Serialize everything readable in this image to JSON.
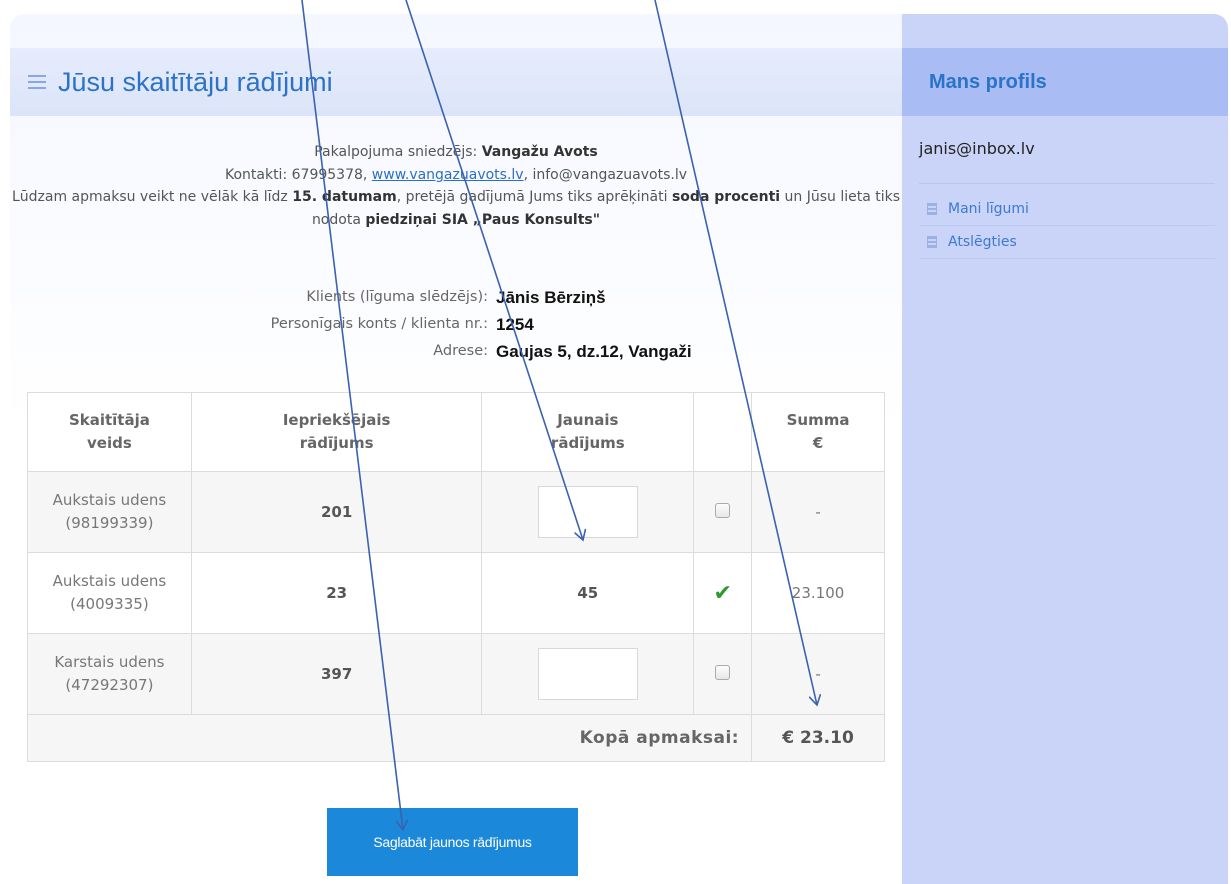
{
  "main": {
    "title": "Jūsu skaitītāju rādījumi",
    "provider": {
      "label": "Pakalpojuma sniedzējs:",
      "name": "Vangažu Avots",
      "contacts_label": "Kontakti:",
      "phone": "67995378",
      "website": "www.vangazuavots.lv",
      "email": "info@vangazuavots.lv",
      "notice_part1": "Lūdzam apmaksu veikt ne vēlāk kā līdz",
      "notice_date": "15. datumam",
      "notice_part2": ", pretējā gadījumā Jums tiks aprēķināti",
      "notice_penalty": "soda procenti",
      "notice_part3": "un Jūsu lieta tiks nodota",
      "notice_collector": "piedziņai SIA „Paus Konsults\""
    },
    "client": {
      "client_label": "Klients (līguma slēdzējs):",
      "client_name": "Jānis Bērziņš",
      "account_label": "Personīgais konts / klienta nr.:",
      "account_number": "1254",
      "address_label": "Adrese:",
      "address": "Gaujas 5, dz.12, Vangaži"
    },
    "table": {
      "headers": {
        "type_line1": "Skaitītāja",
        "type_line2": "veids",
        "prev_line1": "Iepriekšējais",
        "prev_line2": "rādījums",
        "new_line1": "Jaunais",
        "new_line2": "rādījums",
        "sum_line1": "Summa",
        "sum_line2": "€"
      },
      "rows": [
        {
          "type": "Aukstais udens",
          "id": "(98199339)",
          "previous": "201",
          "new": "",
          "sum": "-"
        },
        {
          "type": "Aukstais udens",
          "id": "(4009335)",
          "previous": "23",
          "new": "45",
          "sum": "23.100"
        },
        {
          "type": "Karstais udens",
          "id": "(47292307)",
          "previous": "397",
          "new": "",
          "sum": "-"
        }
      ],
      "total_label": "Kopā apmaksai:",
      "total_value": "€ 23.10"
    },
    "save_button": "Saglabāt jaunos rādījumus"
  },
  "sidebar": {
    "title": "Mans profils",
    "email": "janis@inbox.lv",
    "items": [
      {
        "label": "Mani līgumi",
        "icon": "document-icon"
      },
      {
        "label": "Atslēgties",
        "icon": "document-icon"
      }
    ]
  },
  "colors": {
    "accent": "#2b73c9",
    "button": "#1c88d9",
    "sidebar_bg": "#c9d4f8",
    "arrow": "#3a62b0",
    "check": "#2e9a2e"
  }
}
